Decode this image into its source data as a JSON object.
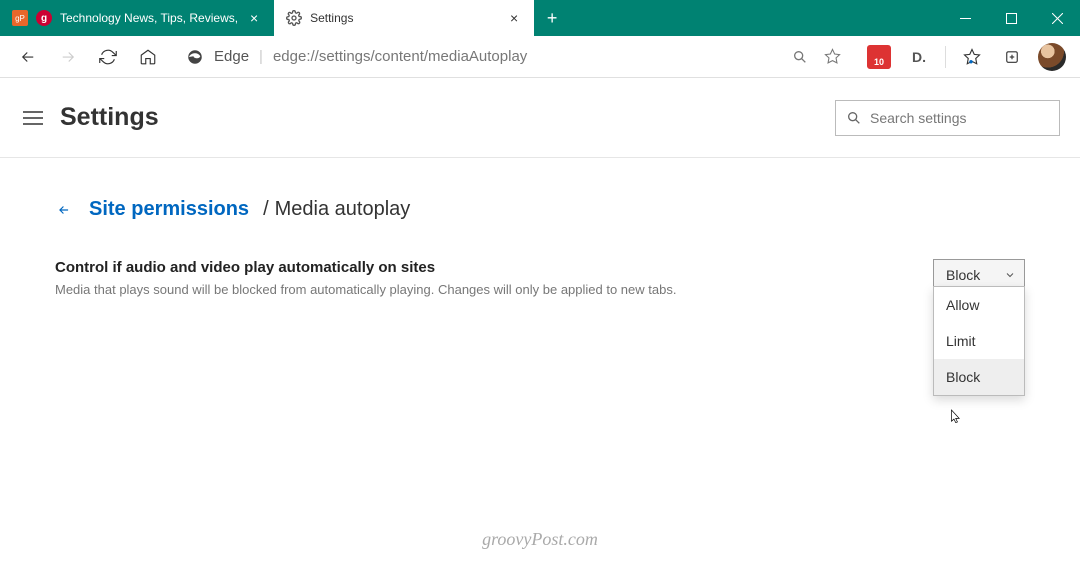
{
  "tabs": [
    {
      "label": "Technology News, Tips, Reviews,"
    },
    {
      "label": "Settings"
    }
  ],
  "toolbar": {
    "edge_label": "Edge",
    "url": "edge://settings/content/mediaAutoplay",
    "ext_badge": "10",
    "ext_d": "D."
  },
  "header": {
    "title": "Settings",
    "search_placeholder": "Search settings"
  },
  "breadcrumb": {
    "parent": "Site permissions",
    "sep": "/",
    "current": "Media autoplay"
  },
  "setting": {
    "label": "Control if audio and video play automatically on sites",
    "desc": "Media that plays sound will be blocked from automatically playing. Changes will only be applied to new tabs.",
    "selected": "Block",
    "options": [
      "Allow",
      "Limit",
      "Block"
    ]
  },
  "watermark": "groovyPost.com"
}
